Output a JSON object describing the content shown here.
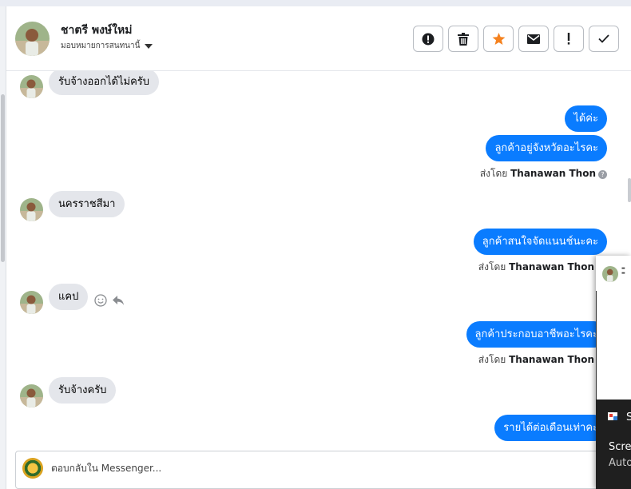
{
  "header": {
    "contact_name": "ชาตรี พงษ์ใหม่",
    "assign_label": "มอบหมายการสนทนานี้"
  },
  "messages": [
    {
      "dir": "in",
      "text": "รับจ้างออกได้ไม่ครับ"
    },
    {
      "dir": "out",
      "text": "ได้ค่ะ"
    },
    {
      "dir": "out",
      "text": "ลูกค้าอยู่จังหวัดอะไรคะ"
    },
    {
      "dir": "in",
      "text": "นครราชสีมา"
    },
    {
      "dir": "out",
      "text": "ลูกค้าสนใจจัดแนนช์นะคะ"
    },
    {
      "dir": "in",
      "text": "แคป"
    },
    {
      "dir": "out",
      "text": "ลูกค้าประกอบอาชีพอะไรคะ"
    },
    {
      "dir": "in",
      "text": "รับจ้างครับ"
    },
    {
      "dir": "out",
      "text": "รายได้ต่อเดือนเท่าคะ"
    }
  ],
  "sent_by": {
    "prefix": "ส่งโดย",
    "agent": "Thanawan Thon"
  },
  "composer": {
    "placeholder": "ตอบกลับใน Messenger..."
  },
  "popup": {
    "s_letter": "S",
    "title_text": "Screen",
    "sub_text": "Auto"
  },
  "colors": {
    "outgoing_bubble": "#0a7cff",
    "incoming_bubble": "#e4e6eb",
    "star": "#f5821f"
  },
  "icons": {
    "alert": "exclamation-circle-icon",
    "trash": "trash-icon",
    "star": "star-icon",
    "mail": "envelope-icon",
    "important": "exclamation-icon",
    "done": "checkmark-icon",
    "emoji": "smiley-icon",
    "reply": "reply-arrow-icon",
    "help": "question-circle-icon"
  }
}
